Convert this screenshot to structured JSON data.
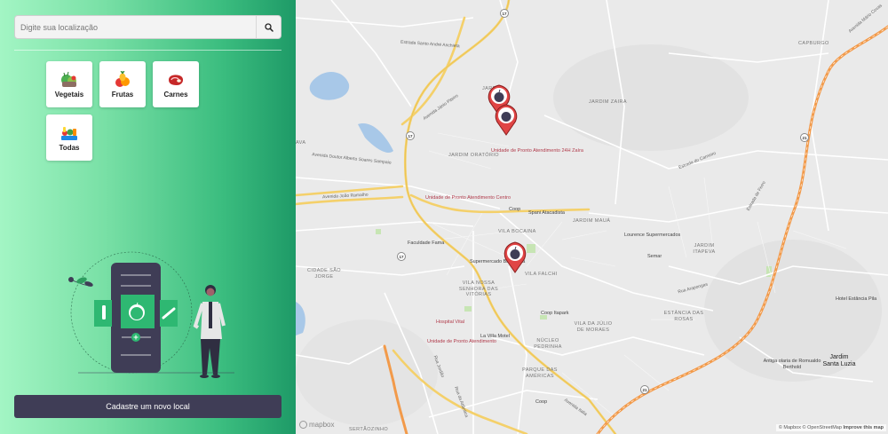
{
  "sidebar": {
    "search": {
      "placeholder": "Digite sua localização",
      "value": ""
    },
    "categories": [
      {
        "label": "Vegetais",
        "icon": "vegetables-icon"
      },
      {
        "label": "Frutas",
        "icon": "fruits-icon"
      },
      {
        "label": "Carnes",
        "icon": "meat-icon"
      },
      {
        "label": "Todas",
        "icon": "all-food-icon"
      }
    ],
    "register_button": "Cadastre um novo local"
  },
  "map": {
    "districts": [
      "JARDIM ZAIRA",
      "JARDIM ORATÓRIO",
      "JARDIM MAUÁ",
      "VILA BOCAINA",
      "VILA FALCHI",
      "CIDADE SÃO JORGE",
      "VILA NOSSA SENHORA DAS VITÓRIAS",
      "JARDIM ITAPEVA",
      "ESTÂNCIA DAS ROSAS",
      "VILA DA JÚLIO DE MORAES",
      "NÚCLEO PEDRINHA",
      "PARQUE DAS AMÉRICAS",
      "CAPBURGO",
      "JARDIM SANTA LUZIA",
      "AVA",
      "JARDIM",
      "SERTÃOZINHO"
    ],
    "streets": [
      "Estrada Santo André Anchieta",
      "Avenida Doutor Alberto Soares Sampaio",
      "Avenida João Ramalho",
      "Avenida Jánio Piteiro",
      "Estrada do Carneiro",
      "Rua Arapongas",
      "Rua Jordão",
      "Avenida Italia",
      "Avenida Mário Covas",
      "Estrada de Ferro",
      "Rua da Atlântica"
    ],
    "pois": [
      "Unidade de Pronto Atendimento 24H Zaíra",
      "Unidade de Pronto Atendimento Centro",
      "Hospital Vital",
      "Unidade de Pronto Atendimento",
      "Coop",
      "Spani Atacadista",
      "Faculdade Fama",
      "Supermercado Barcelona",
      "Coop Itapark",
      "La Villa Motel",
      "Lourence Supermercados",
      "Semar",
      "Hotel Estância Pila",
      "Antiga olaria de Romualdo Berthold"
    ],
    "route_numbers": [
      "17",
      "17",
      "17",
      "21",
      "21"
    ],
    "city_label": "Jardim Santa Luzia",
    "attribution": "© Mapbox © OpenStreetMap",
    "attribution_link": "Improve this map",
    "logo": "mapbox",
    "pins": [
      "store-pin",
      "store-pin",
      "store-pin"
    ]
  },
  "colors": {
    "accent": "#3f3d56",
    "pin": "#e04545",
    "highway": "#f29a4a",
    "major_road": "#f4d06a"
  }
}
